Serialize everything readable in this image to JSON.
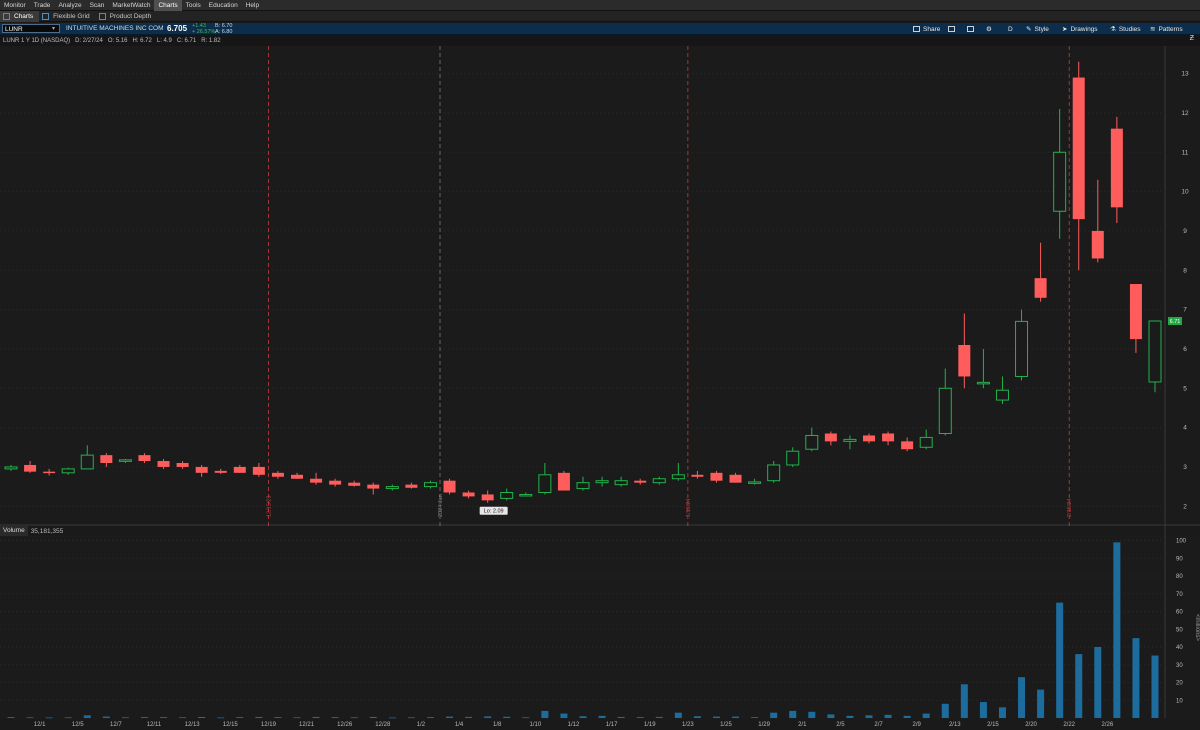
{
  "menu": [
    "Monitor",
    "Trade",
    "Analyze",
    "Scan",
    "MarketWatch",
    "Charts",
    "Tools",
    "Education",
    "Help"
  ],
  "menu_active": "Charts",
  "subtabs": [
    {
      "label": "Charts",
      "active": true
    },
    {
      "label": "Flexible Grid",
      "active": false
    },
    {
      "label": "Product Depth",
      "active": false
    }
  ],
  "symbol_bar": {
    "symbol": "LUNR",
    "company": "INTUITIVE MACHINES INC COM",
    "last": "6.705",
    "change": "+1.43",
    "change_pct": "+ 26.57%",
    "bid": "B: 6.70",
    "ask": "A: 6.80",
    "tools": [
      "Share",
      "D",
      "Style",
      "Drawings",
      "Studies",
      "Patterns"
    ]
  },
  "info_bar": {
    "title": "LUNR 1 Y 1D (NASDAQ)",
    "date": "D: 2/27/24",
    "open": "O: 5.16",
    "high": "H: 6.72",
    "low": "L: 4.9",
    "close": "C: 6.71",
    "range": "R: 1.82"
  },
  "colors": {
    "up": "#22b34a",
    "down": "#ff5c5c",
    "volume": "#1c6d9e",
    "marker": "#c43c3c",
    "bg": "#1a1a1a",
    "grid": "#2b2b2b"
  },
  "price_axis": {
    "ticks": [
      2,
      3,
      4,
      5,
      6,
      7,
      8,
      9,
      10,
      11,
      12,
      13
    ],
    "last_label": "6.71"
  },
  "markers": [
    {
      "label": "12/15/23",
      "at": 13.5
    },
    {
      "label": "2024 Jan",
      "at": 22.5
    },
    {
      "label": "1/19/24",
      "at": 35.5
    },
    {
      "label": "2/16/24",
      "at": 55.5
    }
  ],
  "low_label": "Lo: 2.09",
  "volume_panel": {
    "label": "Volume",
    "value": "35,181,355",
    "axis_label": "<millions>",
    "ticks": [
      10,
      20,
      30,
      40,
      50,
      60,
      70,
      80,
      90,
      100
    ]
  },
  "x_labels": [
    "12/1",
    "12/5",
    "12/7",
    "12/11",
    "12/13",
    "12/15",
    "12/19",
    "12/21",
    "12/26",
    "12/28",
    "1/2",
    "1/4",
    "1/8",
    "1/10",
    "1/12",
    "1/17",
    "1/19",
    "1/23",
    "1/25",
    "1/29",
    "2/1",
    "2/5",
    "2/7",
    "2/9",
    "2/13",
    "2/15",
    "2/20",
    "2/22",
    "2/26"
  ],
  "chart_data": {
    "type": "candlestick",
    "ylim": [
      1.6,
      13.6
    ],
    "volume_ylim": [
      0,
      102
    ],
    "candles": [
      {
        "o": 2.95,
        "h": 3.05,
        "l": 2.9,
        "c": 3.0,
        "v": 0.5
      },
      {
        "o": 3.05,
        "h": 3.15,
        "l": 2.85,
        "c": 2.88,
        "v": 0.4
      },
      {
        "o": 2.88,
        "h": 2.95,
        "l": 2.78,
        "c": 2.85,
        "v": 0.3
      },
      {
        "o": 2.85,
        "h": 2.98,
        "l": 2.8,
        "c": 2.95,
        "v": 0.4
      },
      {
        "o": 2.95,
        "h": 3.55,
        "l": 2.95,
        "c": 3.3,
        "v": 1.5
      },
      {
        "o": 3.3,
        "h": 3.35,
        "l": 3.0,
        "c": 3.1,
        "v": 0.8
      },
      {
        "o": 3.15,
        "h": 3.2,
        "l": 3.1,
        "c": 3.18,
        "v": 0.4
      },
      {
        "o": 3.3,
        "h": 3.35,
        "l": 3.1,
        "c": 3.15,
        "v": 0.5
      },
      {
        "o": 3.15,
        "h": 3.2,
        "l": 2.95,
        "c": 3.0,
        "v": 0.5
      },
      {
        "o": 3.1,
        "h": 3.15,
        "l": 2.95,
        "c": 3.0,
        "v": 0.4
      },
      {
        "o": 3.0,
        "h": 3.05,
        "l": 2.75,
        "c": 2.85,
        "v": 0.6
      },
      {
        "o": 2.9,
        "h": 2.95,
        "l": 2.82,
        "c": 2.85,
        "v": 0.3
      },
      {
        "o": 3.0,
        "h": 3.05,
        "l": 2.85,
        "c": 2.85,
        "v": 0.5
      },
      {
        "o": 3.0,
        "h": 3.1,
        "l": 2.75,
        "c": 2.8,
        "v": 0.6
      },
      {
        "o": 2.85,
        "h": 2.9,
        "l": 2.7,
        "c": 2.75,
        "v": 0.5
      },
      {
        "o": 2.8,
        "h": 2.85,
        "l": 2.7,
        "c": 2.7,
        "v": 0.4
      },
      {
        "o": 2.7,
        "h": 2.85,
        "l": 2.55,
        "c": 2.6,
        "v": 0.6
      },
      {
        "o": 2.65,
        "h": 2.7,
        "l": 2.5,
        "c": 2.55,
        "v": 0.5
      },
      {
        "o": 2.6,
        "h": 2.65,
        "l": 2.5,
        "c": 2.52,
        "v": 0.4
      },
      {
        "o": 2.55,
        "h": 2.6,
        "l": 2.3,
        "c": 2.45,
        "v": 0.6
      },
      {
        "o": 2.45,
        "h": 2.55,
        "l": 2.4,
        "c": 2.5,
        "v": 0.3
      },
      {
        "o": 2.55,
        "h": 2.6,
        "l": 2.45,
        "c": 2.47,
        "v": 0.4
      },
      {
        "o": 2.5,
        "h": 2.65,
        "l": 2.45,
        "c": 2.6,
        "v": 0.5
      },
      {
        "o": 2.65,
        "h": 2.7,
        "l": 2.3,
        "c": 2.35,
        "v": 0.8
      },
      {
        "o": 2.35,
        "h": 2.4,
        "l": 2.2,
        "c": 2.25,
        "v": 0.6
      },
      {
        "o": 2.3,
        "h": 2.4,
        "l": 2.09,
        "c": 2.15,
        "v": 0.9
      },
      {
        "o": 2.2,
        "h": 2.45,
        "l": 2.15,
        "c": 2.35,
        "v": 0.7
      },
      {
        "o": 2.3,
        "h": 2.35,
        "l": 2.25,
        "c": 2.3,
        "v": 0.4
      },
      {
        "o": 2.35,
        "h": 3.1,
        "l": 2.3,
        "c": 2.8,
        "v": 4.0
      },
      {
        "o": 2.85,
        "h": 2.9,
        "l": 2.4,
        "c": 2.4,
        "v": 2.5
      },
      {
        "o": 2.45,
        "h": 2.75,
        "l": 2.4,
        "c": 2.6,
        "v": 1.0
      },
      {
        "o": 2.6,
        "h": 2.75,
        "l": 2.5,
        "c": 2.65,
        "v": 1.2
      },
      {
        "o": 2.55,
        "h": 2.75,
        "l": 2.5,
        "c": 2.65,
        "v": 0.6
      },
      {
        "o": 2.65,
        "h": 2.7,
        "l": 2.55,
        "c": 2.6,
        "v": 0.5
      },
      {
        "o": 2.6,
        "h": 2.75,
        "l": 2.55,
        "c": 2.7,
        "v": 0.6
      },
      {
        "o": 2.7,
        "h": 3.1,
        "l": 2.65,
        "c": 2.8,
        "v": 3.0
      },
      {
        "o": 2.8,
        "h": 2.9,
        "l": 2.7,
        "c": 2.75,
        "v": 1.0
      },
      {
        "o": 2.85,
        "h": 2.9,
        "l": 2.6,
        "c": 2.65,
        "v": 0.8
      },
      {
        "o": 2.8,
        "h": 2.85,
        "l": 2.6,
        "c": 2.6,
        "v": 0.8
      },
      {
        "o": 2.6,
        "h": 2.7,
        "l": 2.55,
        "c": 2.62,
        "v": 0.5
      },
      {
        "o": 2.65,
        "h": 3.15,
        "l": 2.6,
        "c": 3.05,
        "v": 3.0
      },
      {
        "o": 3.05,
        "h": 3.5,
        "l": 3.0,
        "c": 3.4,
        "v": 4.0
      },
      {
        "o": 3.45,
        "h": 4.0,
        "l": 3.4,
        "c": 3.8,
        "v": 3.5
      },
      {
        "o": 3.85,
        "h": 3.9,
        "l": 3.55,
        "c": 3.65,
        "v": 2.0
      },
      {
        "o": 3.65,
        "h": 3.8,
        "l": 3.45,
        "c": 3.7,
        "v": 1.2
      },
      {
        "o": 3.8,
        "h": 3.85,
        "l": 3.6,
        "c": 3.65,
        "v": 1.5
      },
      {
        "o": 3.85,
        "h": 3.9,
        "l": 3.55,
        "c": 3.65,
        "v": 1.8
      },
      {
        "o": 3.65,
        "h": 3.75,
        "l": 3.4,
        "c": 3.45,
        "v": 1.2
      },
      {
        "o": 3.5,
        "h": 3.95,
        "l": 3.45,
        "c": 3.75,
        "v": 2.5
      },
      {
        "o": 3.85,
        "h": 5.5,
        "l": 3.8,
        "c": 5.0,
        "v": 8.0
      },
      {
        "o": 6.1,
        "h": 6.9,
        "l": 5.0,
        "c": 5.3,
        "v": 19.0
      },
      {
        "o": 5.15,
        "h": 6.0,
        "l": 5.0,
        "c": 5.15,
        "v": 9.0
      },
      {
        "o": 4.7,
        "h": 5.3,
        "l": 4.6,
        "c": 4.95,
        "v": 6.0
      },
      {
        "o": 5.3,
        "h": 7.0,
        "l": 5.2,
        "c": 6.7,
        "v": 23.0
      },
      {
        "o": 7.8,
        "h": 8.7,
        "l": 7.2,
        "c": 7.3,
        "v": 16.0
      },
      {
        "o": 9.5,
        "h": 12.1,
        "l": 8.8,
        "c": 11.0,
        "v": 65.0
      },
      {
        "o": 12.9,
        "h": 13.3,
        "l": 8.0,
        "c": 9.3,
        "v": 36.0
      },
      {
        "o": 9.0,
        "h": 10.3,
        "l": 8.2,
        "c": 8.3,
        "v": 40.0
      },
      {
        "o": 11.6,
        "h": 11.9,
        "l": 9.2,
        "c": 9.6,
        "v": 99.0
      },
      {
        "o": 7.65,
        "h": 7.65,
        "l": 5.9,
        "c": 6.25,
        "v": 45.0
      },
      {
        "o": 5.16,
        "h": 6.72,
        "l": 4.9,
        "c": 6.71,
        "v": 35.2
      }
    ]
  }
}
